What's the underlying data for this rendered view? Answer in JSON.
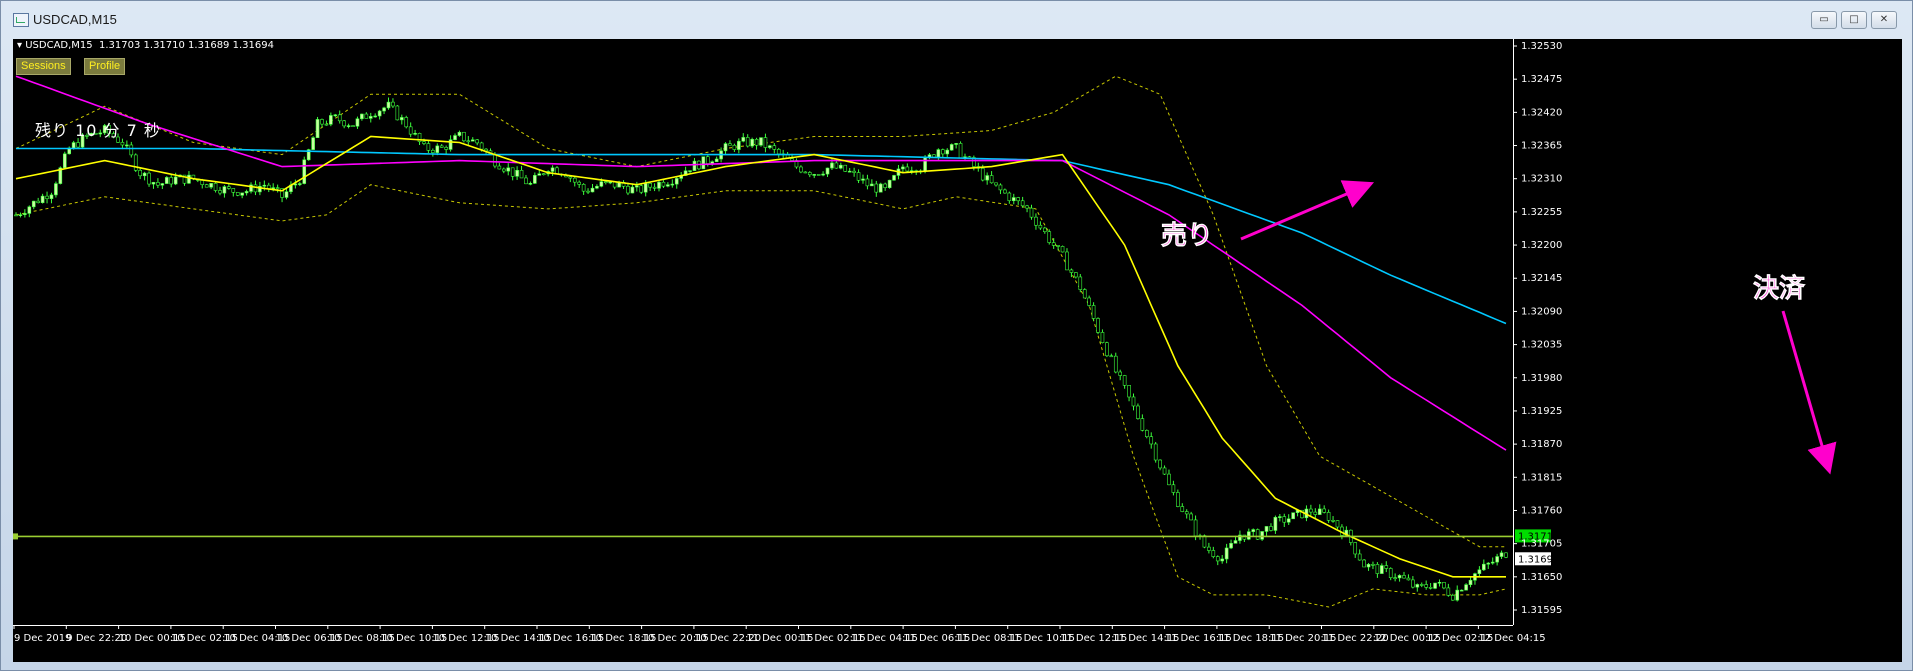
{
  "window": {
    "title": "USDCAD,M15",
    "controls": {
      "minimize": "▭",
      "maximize": "□",
      "close": "✕"
    }
  },
  "chart": {
    "symbol_info": "USDCAD,M15  1.31703 1.31710 1.31689 1.31694",
    "buttons": {
      "sessions": "Sessions",
      "profile": "Profile"
    },
    "countdown": "残り 10 分 7 秒",
    "annotations": {
      "sell": "売り",
      "close": "決済"
    },
    "colors": {
      "background": "#000000",
      "candle_up": "#c8ffa0",
      "candle_down": "#000000",
      "candle_wick": "#3cff3c",
      "ma_fast": "#ffff00",
      "ma_mid": "#ff00ff",
      "ma_slow": "#00c8ff",
      "bollinger": "#c8c800",
      "hline": "#9acd32",
      "annotation": "#ff00cc"
    },
    "icons": {
      "symbol-menu": "triangle-down-icon",
      "app": "chart-window-icon"
    }
  },
  "chart_data": {
    "type": "candlestick",
    "symbol": "USDCAD",
    "timeframe": "M15",
    "y_ticks": [
      "1.32530",
      "1.32475",
      "1.32420",
      "1.32365",
      "1.32310",
      "1.32255",
      "1.32200",
      "1.32145",
      "1.32090",
      "1.32035",
      "1.31980",
      "1.31925",
      "1.31870",
      "1.31815",
      "1.31760",
      "1.31705",
      "1.31650",
      "1.31595"
    ],
    "ylim": [
      1.31595,
      1.3253
    ],
    "x_ticks": [
      "9 Dec 2019",
      "9 Dec 22:20",
      "10 Dec 00:15",
      "10 Dec 02:15",
      "10 Dec 04:15",
      "10 Dec 06:15",
      "10 Dec 08:15",
      "10 Dec 10:15",
      "10 Dec 12:15",
      "10 Dec 14:15",
      "10 Dec 16:15",
      "10 Dec 18:15",
      "10 Dec 20:15",
      "10 Dec 22:20",
      "11 Dec 00:15",
      "11 Dec 02:15",
      "11 Dec 04:15",
      "11 Dec 06:15",
      "11 Dec 08:15",
      "11 Dec 10:15",
      "11 Dec 12:15",
      "11 Dec 14:15",
      "11 Dec 16:15",
      "11 Dec 18:15",
      "11 Dec 20:15",
      "11 Dec 22:20",
      "12 Dec 00:15",
      "12 Dec 02:15",
      "12 Dec 04:15"
    ],
    "price_labels": {
      "line": "1.31717",
      "bid": "1.31694"
    },
    "hline_price": 1.31717,
    "last_ohlc": {
      "open": 1.31703,
      "high": 1.3171,
      "low": 1.31689,
      "close": 1.31694
    },
    "price_path": [
      [
        0,
        1.3225
      ],
      [
        4,
        1.3227
      ],
      [
        8,
        1.3229
      ],
      [
        12,
        1.3236
      ],
      [
        16,
        1.3238
      ],
      [
        20,
        1.3239
      ],
      [
        24,
        1.3237
      ],
      [
        28,
        1.3232
      ],
      [
        32,
        1.323
      ],
      [
        36,
        1.3231
      ],
      [
        40,
        1.3231
      ],
      [
        44,
        1.323
      ],
      [
        48,
        1.3229
      ],
      [
        52,
        1.3229
      ],
      [
        56,
        1.323
      ],
      [
        60,
        1.3228
      ],
      [
        64,
        1.3231
      ],
      [
        68,
        1.324
      ],
      [
        72,
        1.3241
      ],
      [
        76,
        1.324
      ],
      [
        80,
        1.3242
      ],
      [
        84,
        1.3243
      ],
      [
        88,
        1.324
      ],
      [
        92,
        1.3236
      ],
      [
        96,
        1.3236
      ],
      [
        100,
        1.3238
      ],
      [
        104,
        1.3237
      ],
      [
        108,
        1.3234
      ],
      [
        112,
        1.3232
      ],
      [
        116,
        1.323
      ],
      [
        120,
        1.3233
      ],
      [
        124,
        1.3232
      ],
      [
        128,
        1.3229
      ],
      [
        132,
        1.323
      ],
      [
        136,
        1.323
      ],
      [
        140,
        1.3229
      ],
      [
        144,
        1.323
      ],
      [
        148,
        1.3231
      ],
      [
        152,
        1.3233
      ],
      [
        156,
        1.3234
      ],
      [
        160,
        1.3236
      ],
      [
        164,
        1.3237
      ],
      [
        168,
        1.3237
      ],
      [
        172,
        1.3235
      ],
      [
        176,
        1.3233
      ],
      [
        180,
        1.3232
      ],
      [
        184,
        1.3233
      ],
      [
        188,
        1.3232
      ],
      [
        192,
        1.323
      ],
      [
        196,
        1.3229
      ],
      [
        200,
        1.3233
      ],
      [
        204,
        1.3233
      ],
      [
        208,
        1.3236
      ],
      [
        212,
        1.3236
      ],
      [
        216,
        1.3233
      ],
      [
        220,
        1.323
      ],
      [
        224,
        1.3228
      ],
      [
        228,
        1.3226
      ],
      [
        232,
        1.3222
      ],
      [
        236,
        1.3218
      ],
      [
        240,
        1.3213
      ],
      [
        244,
        1.3206
      ],
      [
        248,
        1.3199
      ],
      [
        252,
        1.3193
      ],
      [
        256,
        1.3187
      ],
      [
        260,
        1.318
      ],
      [
        264,
        1.3175
      ],
      [
        268,
        1.317
      ],
      [
        272,
        1.3168
      ],
      [
        276,
        1.3172
      ],
      [
        280,
        1.3172
      ],
      [
        284,
        1.3174
      ],
      [
        288,
        1.3175
      ],
      [
        292,
        1.3176
      ],
      [
        296,
        1.3175
      ],
      [
        300,
        1.3172
      ],
      [
        304,
        1.3167
      ],
      [
        308,
        1.3166
      ],
      [
        312,
        1.3165
      ],
      [
        316,
        1.3163
      ],
      [
        320,
        1.3164
      ],
      [
        324,
        1.3162
      ],
      [
        328,
        1.3165
      ],
      [
        332,
        1.3167
      ],
      [
        336,
        1.3169
      ]
    ],
    "ma_fast": [
      [
        0,
        1.3231
      ],
      [
        20,
        1.3234
      ],
      [
        40,
        1.3231
      ],
      [
        60,
        1.3229
      ],
      [
        80,
        1.3238
      ],
      [
        100,
        1.3237
      ],
      [
        120,
        1.3232
      ],
      [
        140,
        1.323
      ],
      [
        160,
        1.3233
      ],
      [
        180,
        1.3235
      ],
      [
        200,
        1.3232
      ],
      [
        220,
        1.3233
      ],
      [
        236,
        1.3235
      ],
      [
        250,
        1.322
      ],
      [
        262,
        1.32
      ],
      [
        272,
        1.3188
      ],
      [
        284,
        1.3178
      ],
      [
        300,
        1.3172
      ],
      [
        312,
        1.3168
      ],
      [
        324,
        1.3165
      ],
      [
        336,
        1.3165
      ]
    ],
    "ma_mid": [
      [
        0,
        1.3248
      ],
      [
        30,
        1.324
      ],
      [
        60,
        1.3233
      ],
      [
        100,
        1.3234
      ],
      [
        140,
        1.3233
      ],
      [
        180,
        1.3234
      ],
      [
        236,
        1.3234
      ],
      [
        260,
        1.3225
      ],
      [
        290,
        1.321
      ],
      [
        310,
        1.3198
      ],
      [
        336,
        1.3186
      ]
    ],
    "ma_slow": [
      [
        0,
        1.3236
      ],
      [
        40,
        1.3236
      ],
      [
        100,
        1.3235
      ],
      [
        180,
        1.3235
      ],
      [
        236,
        1.3234
      ],
      [
        260,
        1.323
      ],
      [
        290,
        1.3222
      ],
      [
        310,
        1.3215
      ],
      [
        336,
        1.3207
      ]
    ],
    "bb_upper": [
      [
        0,
        1.3236
      ],
      [
        20,
        1.3243
      ],
      [
        40,
        1.3237
      ],
      [
        60,
        1.3235
      ],
      [
        80,
        1.3245
      ],
      [
        100,
        1.3245
      ],
      [
        120,
        1.3236
      ],
      [
        140,
        1.3233
      ],
      [
        160,
        1.3236
      ],
      [
        180,
        1.3238
      ],
      [
        200,
        1.3238
      ],
      [
        220,
        1.3239
      ],
      [
        234,
        1.3242
      ],
      [
        248,
        1.3248
      ],
      [
        258,
        1.3245
      ],
      [
        270,
        1.3225
      ],
      [
        282,
        1.32
      ],
      [
        294,
        1.3185
      ],
      [
        306,
        1.318
      ],
      [
        318,
        1.3175
      ],
      [
        330,
        1.317
      ],
      [
        336,
        1.317
      ]
    ],
    "bb_lower": [
      [
        0,
        1.3225
      ],
      [
        20,
        1.3228
      ],
      [
        40,
        1.3226
      ],
      [
        60,
        1.3224
      ],
      [
        70,
        1.3225
      ],
      [
        80,
        1.323
      ],
      [
        100,
        1.3227
      ],
      [
        120,
        1.3226
      ],
      [
        140,
        1.3227
      ],
      [
        160,
        1.3229
      ],
      [
        180,
        1.3229
      ],
      [
        200,
        1.3226
      ],
      [
        212,
        1.3228
      ],
      [
        230,
        1.3226
      ],
      [
        242,
        1.321
      ],
      [
        252,
        1.3185
      ],
      [
        262,
        1.3165
      ],
      [
        270,
        1.3162
      ],
      [
        282,
        1.3162
      ],
      [
        296,
        1.316
      ],
      [
        306,
        1.3163
      ],
      [
        318,
        1.3162
      ],
      [
        330,
        1.3162
      ],
      [
        336,
        1.3163
      ]
    ]
  }
}
